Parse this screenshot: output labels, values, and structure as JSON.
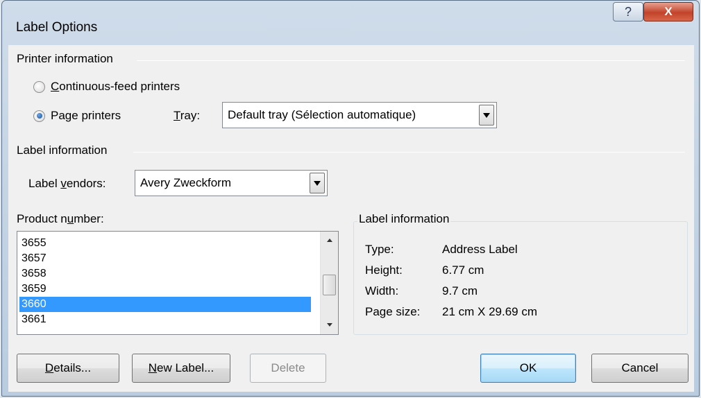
{
  "window": {
    "title": "Label Options",
    "help_glyph": "?",
    "close_glyph": "X"
  },
  "printer_info": {
    "group_title": "Printer information",
    "continuous": {
      "prefix": "",
      "accel": "C",
      "rest": "ontinuous-feed printers",
      "selected": false
    },
    "page": {
      "prefix": "Pa",
      "accel": "g",
      "rest": "e printers",
      "selected": true
    },
    "tray": {
      "accel": "T",
      "rest": "ray:",
      "value": "Default tray (Sélection automatique)"
    }
  },
  "label_info": {
    "group_title": "Label information",
    "vendors": {
      "prefix": "Label ",
      "accel": "v",
      "rest": "endors:",
      "value": "Avery Zweckform"
    },
    "product": {
      "prefix": "Product n",
      "accel": "u",
      "rest": "mber:"
    },
    "products": [
      "3655",
      "3657",
      "3658",
      "3659",
      "3660",
      "3661"
    ],
    "selected_product": "3660"
  },
  "details": {
    "group_title": "Label information",
    "rows": [
      {
        "key": "Type:",
        "value": "Address Label"
      },
      {
        "key": "Height:",
        "value": "6.77 cm"
      },
      {
        "key": "Width:",
        "value": "9.7 cm"
      },
      {
        "key": "Page size:",
        "value": "21 cm X 29.69 cm"
      }
    ]
  },
  "buttons": {
    "details": {
      "accel": "D",
      "rest": "etails..."
    },
    "new_label": {
      "accel": "N",
      "rest": "ew Label..."
    },
    "delete": "Delete",
    "ok": "OK",
    "cancel": "Cancel"
  }
}
